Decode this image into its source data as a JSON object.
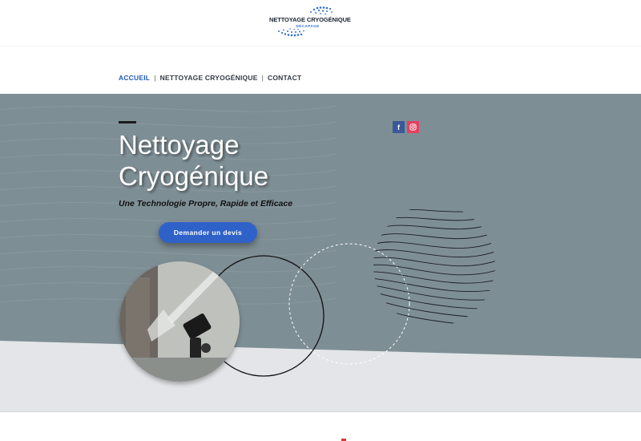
{
  "brand": {
    "name": "NETTOYAGE CRYOGÉNIQUE",
    "tagline": "DÉCAPAGE",
    "accent_color": "#2a6fd6"
  },
  "nav": {
    "items": [
      {
        "label": "ACCUEIL",
        "active": true
      },
      {
        "label": "NETTOYAGE CRYOGÉNIQUE",
        "active": false
      },
      {
        "label": "CONTACT",
        "active": false
      }
    ],
    "separator": "|"
  },
  "hero": {
    "title": "Nettoyage Cryogénique",
    "subtitle": "Une Technologie Propre, Rapide et Efficace",
    "cta_label": "Demander un devis",
    "background_color": "#7e8e95",
    "cta_color": "#2f62c8"
  },
  "social": {
    "facebook_icon": "facebook-icon",
    "instagram_icon": "instagram-icon",
    "facebook_glyph": "f",
    "instagram_glyph": "◎"
  }
}
